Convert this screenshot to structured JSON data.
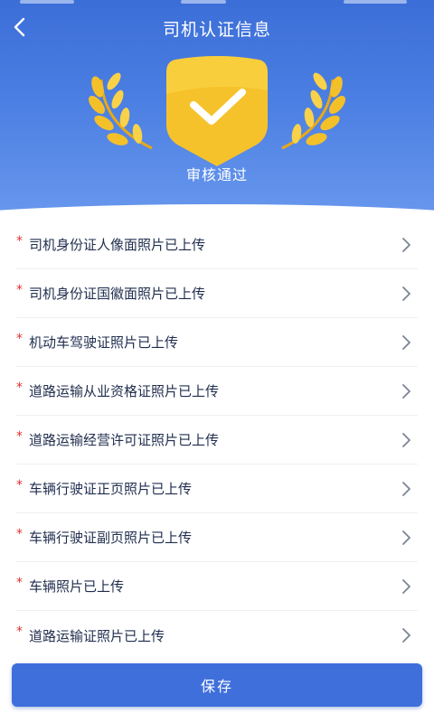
{
  "header": {
    "title": "司机认证信息"
  },
  "status": {
    "text": "审核通过"
  },
  "items": [
    {
      "label": "司机身份证人像面照片已上传"
    },
    {
      "label": "司机身份证国徽面照片已上传"
    },
    {
      "label": "机动车驾驶证照片已上传"
    },
    {
      "label": "道路运输从业资格证照片已上传"
    },
    {
      "label": "道路运输经营许可证照片已上传"
    },
    {
      "label": "车辆行驶证正页照片已上传"
    },
    {
      "label": "车辆行驶证副页照片已上传"
    },
    {
      "label": "车辆照片已上传"
    },
    {
      "label": "道路运输证照片已上传"
    }
  ],
  "required_marker": "*",
  "save_button": {
    "label": "保存"
  },
  "icons": {
    "back": "back-arrow-icon",
    "badge": "check-shield-icon",
    "laurel": "laurel-icon",
    "row_chevron": "chevron-right-icon"
  },
  "colors": {
    "primary": "#3f6fdb",
    "badge_gold": "#f6c22c",
    "required_red": "#e03131",
    "text_dark": "#1f2d4d",
    "chevron_gray": "#7b8494"
  }
}
